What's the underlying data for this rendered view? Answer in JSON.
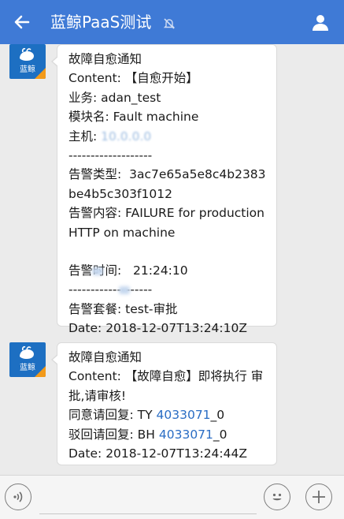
{
  "header": {
    "title": "蓝鲸PaaS测试",
    "back_icon": "arrow-left-icon",
    "mute_icon": "bell-muted-icon",
    "contact_icon": "person-icon",
    "bg_color": "#3f7ad6"
  },
  "avatar": {
    "logo_text": "蓝鲸",
    "bg_color": "#1d6fc2",
    "accent_color": "#f29a1a"
  },
  "messages": [
    {
      "title": "故障自愈通知",
      "content": "Content: 【自愈开始】",
      "business": "业务: adan_test",
      "module": "模块名: Fault machine",
      "host_label": "主机: ",
      "host_ip": "10.0.0.0",
      "divider1": "-------------------",
      "alarm_type_label": "告警类型:",
      "alarm_type_value": "3ac7e65a5e8c4b2383be4b5c303f1012",
      "alarm_content": "告警内容: FAILURE for production HTTP on machine",
      "alarm_time_label": "告警时间:",
      "alarm_time_value": "21:24:10",
      "divider2": "-------------------",
      "alarm_package": "告警套餐: test-审批",
      "date": "Date: 2018-12-07T13:24:10Z"
    },
    {
      "title": "故障自愈通知",
      "content": "Content: 【故障自愈】即将执行 审批,请审核!",
      "agree_label": "同意请回复: TY ",
      "agree_code": "4033071",
      "agree_suffix": "_0",
      "reject_label": "驳回请回复: BH ",
      "reject_code": "4033071",
      "reject_suffix": "_0",
      "date": "Date: 2018-12-07T13:24:44Z"
    }
  ],
  "input_bar": {
    "voice_icon": "voice-icon",
    "emoji_icon": "emoji-icon",
    "plus_icon": "plus-icon"
  }
}
